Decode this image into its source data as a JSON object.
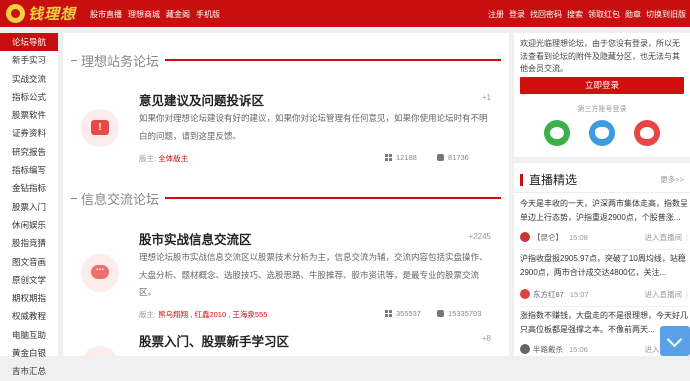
{
  "header": {
    "logo_text": "钱理想",
    "nav": [
      "股市直播",
      "理想商城",
      "藏金阁",
      "手机版"
    ],
    "right": [
      "注册",
      "登录",
      "找回密码",
      "搜索",
      "领取红包",
      "勋章",
      "切换到旧版"
    ]
  },
  "sidebar": {
    "items": [
      "论坛导航",
      "新手实习",
      "实战交流",
      "指标公式",
      "股票软件",
      "证券资料",
      "研究报告",
      "指标编写",
      "金钻指标",
      "股票入门",
      "休闲娱乐",
      "股指竞猜",
      "图文音画",
      "原创文学",
      "期权期指",
      "权威教程",
      "电脑互助",
      "黄金白银",
      "吉市汇总"
    ]
  },
  "sections": [
    {
      "title": "理想站务论坛",
      "forum": {
        "name": "意见建议及问题投诉区",
        "count": "+1",
        "desc": "如果你对理想论坛建设有好的建议，如果你对论坛管理有任何意见，如果你使用论坛时有不明白的问题，请到这里反馈。",
        "mod_label": "版主:",
        "mods": "全体版主",
        "topics": "12188",
        "posts": "81736"
      }
    },
    {
      "title": "信息交流论坛",
      "forum": {
        "name": "股市实战信息交流区",
        "count": "+2245",
        "desc": "理想论坛股市实战信息交流区以股票技术分析为主，信息交流为辅，交流内容包括实盘操作、大盘分析、题材概念、选股技巧、选股思路、牛股推荐、股市资讯等，是最专业的股票交流区。",
        "mod_label": "版主:",
        "mods": "熊乌翔翔 , 红鑫2010 , 王海泉555",
        "topics": "355537",
        "posts": "15335703"
      }
    },
    {
      "forum": {
        "name": "股票入门、股票新手学习区",
        "count": "+8"
      }
    }
  ],
  "login_panel": {
    "welcome": "欢迎光临理想论坛，由于您没有登录，所以无法查看到论坛的附件及隐藏分区，也无法与其他会员交流。",
    "login_button": "立即登录",
    "third_party": "第三方账号登录"
  },
  "live": {
    "title": "直播精选",
    "more": "更多>>",
    "posts": [
      {
        "text": "今天是丰收的一天，沪深两市集体走高，指数呈单边上行态势，沪指重返2900点，个股普涨...",
        "author": "【昆仑】",
        "time": "15:08",
        "enter": "进入直播间"
      },
      {
        "text": "沪指收盘报2905.97点，突破了10周均线，站稳2900点，两市合计成交达4800亿，关注...",
        "author": "东方红87",
        "time": "15:07",
        "enter": "进入直播间"
      },
      {
        "text": "涨指数不赚钱，大盘走的不是很理想，今天好几只高位板都是强撑之本。不像前两天...",
        "author": "半路戴杀",
        "time": "15:06",
        "enter": "进入直播间"
      }
    ]
  },
  "colors": {
    "brand_red": "#c80f0f",
    "wechat_green": "#3bb04b",
    "qq_blue": "#3d9be0",
    "weibo_red": "#e94545"
  }
}
